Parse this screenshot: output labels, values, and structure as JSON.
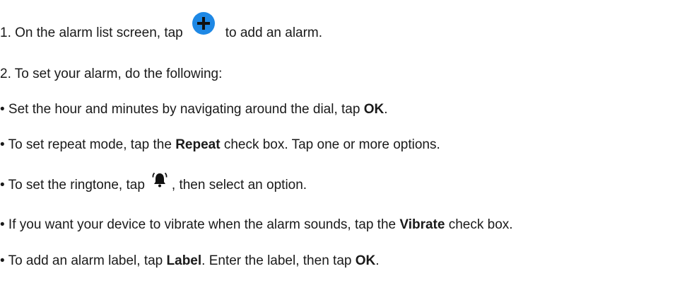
{
  "steps": {
    "step1": {
      "before": "1. On the alarm list screen, tap",
      "icon": "add-circle-icon",
      "after": "to add an alarm."
    },
    "step2": {
      "text": "2. To set your alarm, do the following:"
    }
  },
  "bullets": [
    {
      "pre": "• Set the hour and minutes by navigating around the dial, tap ",
      "bold": "OK",
      "post": "."
    },
    {
      "pre": "• To set repeat mode, tap the ",
      "bold": "Repeat",
      "post": " check box. Tap one or more options."
    },
    {
      "pre": "• To set the ringtone, tap",
      "icon": "alarm-bell-icon",
      "post": ", then select an option."
    },
    {
      "pre": "• If you want your device to vibrate when the alarm sounds, tap the ",
      "bold": "Vibrate",
      "post": " check box."
    },
    {
      "pre": "• To add an alarm label, tap ",
      "bold": "Label",
      "mid": ". Enter the label, then tap ",
      "bold2": "OK",
      "post": "."
    }
  ],
  "colors": {
    "accent": "#1e88e5",
    "text": "#1a1a1a"
  }
}
